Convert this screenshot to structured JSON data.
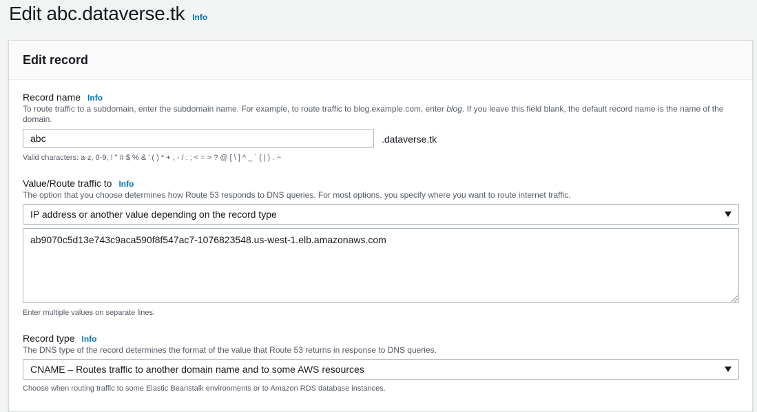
{
  "page": {
    "title": "Edit abc.dataverse.tk",
    "info": "Info"
  },
  "panel": {
    "title": "Edit record"
  },
  "record_name": {
    "label": "Record name",
    "info": "Info",
    "desc_pre": "To route traffic to a subdomain, enter the subdomain name. For example, to route traffic to blog.example.com, enter ",
    "desc_em": "blog",
    "desc_post": ". If you leave this field blank, the default record name is the name of the domain.",
    "value": "abc",
    "suffix": ".dataverse.tk",
    "hint": "Valid characters: a-z, 0-9, ! \" # $ % & ' ( ) * + , - / : ; < = > ? @ [ \\ ] ^ _ ` { | } . ~"
  },
  "value_route": {
    "label": "Value/Route traffic to",
    "info": "Info",
    "desc": "The option that you choose determines how Route 53 responds to DNS queries. For most options, you specify where you want to route internet traffic.",
    "selected": "IP address or another value depending on the record type",
    "value": "ab9070c5d13e743c9aca590f8f547ac7-1076823548.us-west-1.elb.amazonaws.com",
    "hint": "Enter multiple values on separate lines."
  },
  "record_type": {
    "label": "Record type",
    "info": "Info",
    "desc": "The DNS type of the record determines the format of the value that Route 53 returns in response to DNS queries.",
    "selected": "CNAME – Routes traffic to another domain name and to some AWS resources",
    "hint": "Choose when routing traffic to some Elastic Beanstalk environments or to Amazon RDS database instances."
  },
  "colors": {
    "link": "#0073bb",
    "background": "#f2f3f3",
    "border": "#aab7b8"
  }
}
